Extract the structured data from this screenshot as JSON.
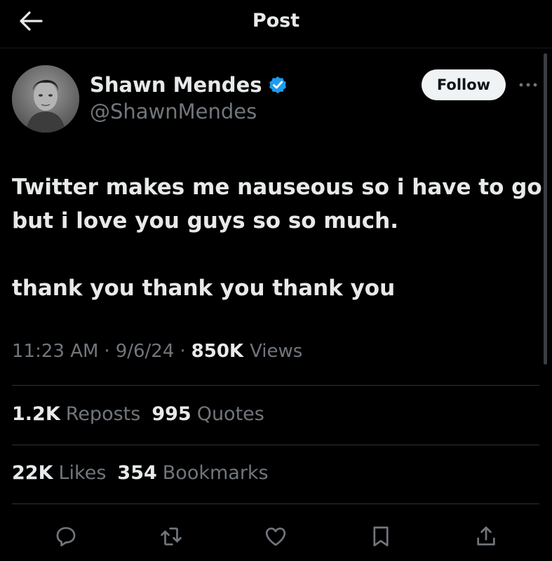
{
  "header": {
    "title": "Post",
    "back_icon": "arrow-left-icon"
  },
  "author": {
    "display_name": "Shawn Mendes",
    "handle": "@ShawnMendes",
    "verified": true,
    "verified_color": "#1d9bf0",
    "follow_label": "Follow"
  },
  "post": {
    "lines": [
      "Twitter makes me nauseous so i have to go",
      "but i love you guys so so much.",
      "thank you thank you thank you"
    ],
    "time": "11:23 AM",
    "date": "9/6/24",
    "views_count": "850K",
    "views_label": "Views"
  },
  "stats": {
    "reposts_count": "1.2K",
    "reposts_label": "Reposts",
    "quotes_count": "995",
    "quotes_label": "Quotes",
    "likes_count": "22K",
    "likes_label": "Likes",
    "bookmarks_count": "354",
    "bookmarks_label": "Bookmarks"
  },
  "actions": [
    "reply-icon",
    "repost-icon",
    "like-icon",
    "bookmark-icon",
    "share-icon"
  ],
  "colors": {
    "background": "#000000",
    "text_primary": "#e7e9ea",
    "text_secondary": "#71767b",
    "divider": "#2f3336"
  }
}
